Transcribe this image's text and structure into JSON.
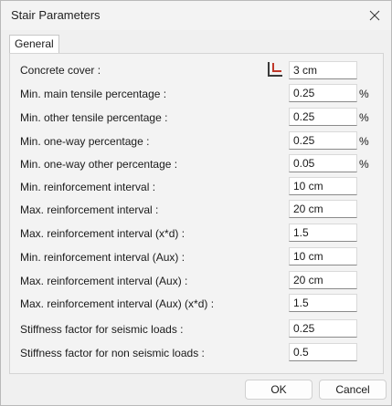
{
  "window": {
    "title": "Stair Parameters"
  },
  "tabs": [
    {
      "label": "General"
    }
  ],
  "rows": [
    {
      "label": "Concrete cover :",
      "value": "3 cm",
      "unit": ""
    },
    {
      "label": "Min. main tensile percentage :",
      "value": "0.25",
      "unit": "%"
    },
    {
      "label": "Min. other tensile percentage :",
      "value": "0.25",
      "unit": "%"
    },
    {
      "label": "Min. one-way percentage :",
      "value": "0.25",
      "unit": "%"
    },
    {
      "label": "Min. one-way other percentage :",
      "value": "0.05",
      "unit": "%"
    },
    {
      "label": "Min. reinforcement interval :",
      "value": "10 cm",
      "unit": ""
    },
    {
      "label": "Max. reinforcement interval :",
      "value": "20 cm",
      "unit": ""
    },
    {
      "label": "Max. reinforcement interval (x*d) :",
      "value": "1.5",
      "unit": ""
    },
    {
      "label": "Min. reinforcement interval (Aux) :",
      "value": "10 cm",
      "unit": ""
    },
    {
      "label": "Max. reinforcement interval (Aux) :",
      "value": "20 cm",
      "unit": ""
    },
    {
      "label": "Max. reinforcement interval (Aux) (x*d) :",
      "value": "1.5",
      "unit": ""
    },
    {
      "label": "Stiffness factor for seismic loads :",
      "value": "0.25",
      "unit": ""
    },
    {
      "label": "Stiffness factor for non seismic loads :",
      "value": "0.5",
      "unit": ""
    }
  ],
  "buttons": {
    "ok": "OK",
    "cancel": "Cancel"
  },
  "colors": {
    "cover_icon_accent": "#c0392b"
  }
}
